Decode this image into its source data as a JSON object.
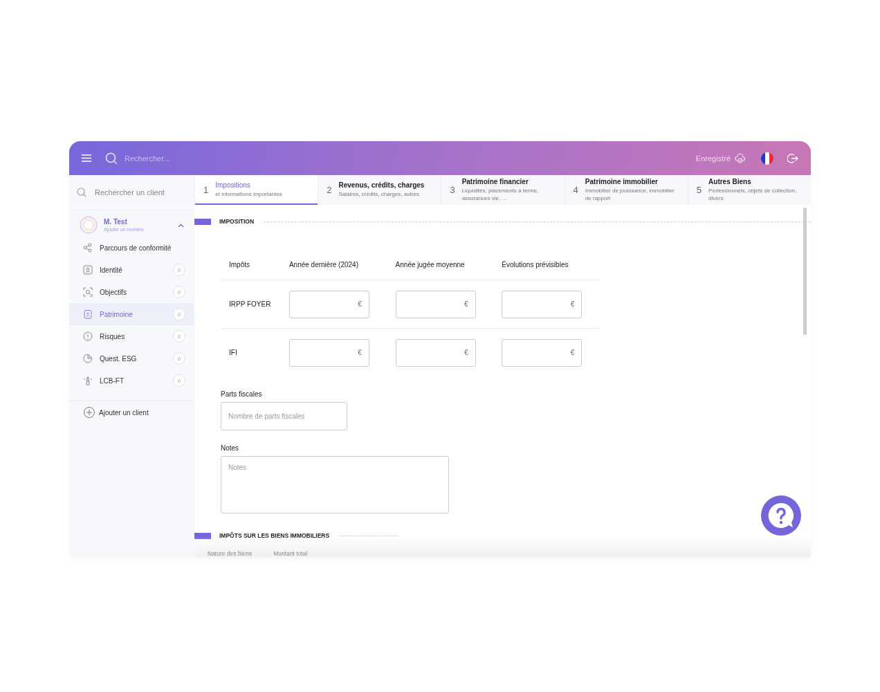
{
  "header": {
    "search_placeholder": "Rechercher...",
    "save_status": "Enregistré"
  },
  "sidebar": {
    "search_placeholder": "Rechercher un client",
    "client": {
      "name": "M. Test",
      "subtitle": "Ajouter un numéro",
      "expanded": true
    },
    "items": [
      {
        "label": "Parcours de conformité",
        "selected": false
      },
      {
        "label": "Identité",
        "count": "0",
        "selected": false
      },
      {
        "label": "Objectifs",
        "count": "0",
        "selected": false
      },
      {
        "label": "Patrimoine",
        "count": "0",
        "selected": true
      },
      {
        "label": "Risques",
        "count": "0",
        "selected": false
      },
      {
        "label": "Quest. ESG",
        "count": "0",
        "selected": false
      },
      {
        "label": "LCB-FT",
        "count": "0",
        "selected": false
      }
    ],
    "add_client": "Ajouter un client"
  },
  "steps": [
    {
      "number": "1",
      "title": "Impositions",
      "subtitle": "et informations importantes",
      "selected": true
    },
    {
      "number": "2",
      "title": "Revenus, crédits, charges",
      "subtitle": "Salaires, crédits, charges, autres",
      "selected": false
    },
    {
      "number": "3",
      "title": "Patrimoine financier",
      "subtitle": "Liquidités, placements à terme, assurances vie, ...",
      "selected": false
    },
    {
      "number": "4",
      "title": "Patrimoine immobilier",
      "subtitle": "Immobilier de jouissance, immobilier de rapport",
      "selected": false
    },
    {
      "number": "5",
      "title": "Autres Biens",
      "subtitle": "Professionnels, objets de collection, divers",
      "selected": false
    }
  ],
  "imposition": {
    "title": "IMPOSITION",
    "columns": [
      "Impôts",
      "Année dernière (2024)",
      "Année jugée moyenne",
      "Évolutions prévisibles"
    ],
    "rows": [
      {
        "cells": [
          "IRPP FOYER",
          "€",
          "€",
          "€"
        ]
      },
      {
        "cells": [
          "IFI",
          "€",
          "€",
          "€"
        ]
      }
    ],
    "parts_fiscales": {
      "label": "Parts fiscales",
      "placeholder": "Nombre de parts fiscales"
    },
    "notes": {
      "label": "Notes",
      "placeholder": "Notes"
    }
  },
  "real_estate_tax": {
    "title": "IMPÔTS SUR LES BIENS IMMOBILIERS",
    "columns": [
      "Nature des biens",
      "Montant total"
    ]
  }
}
